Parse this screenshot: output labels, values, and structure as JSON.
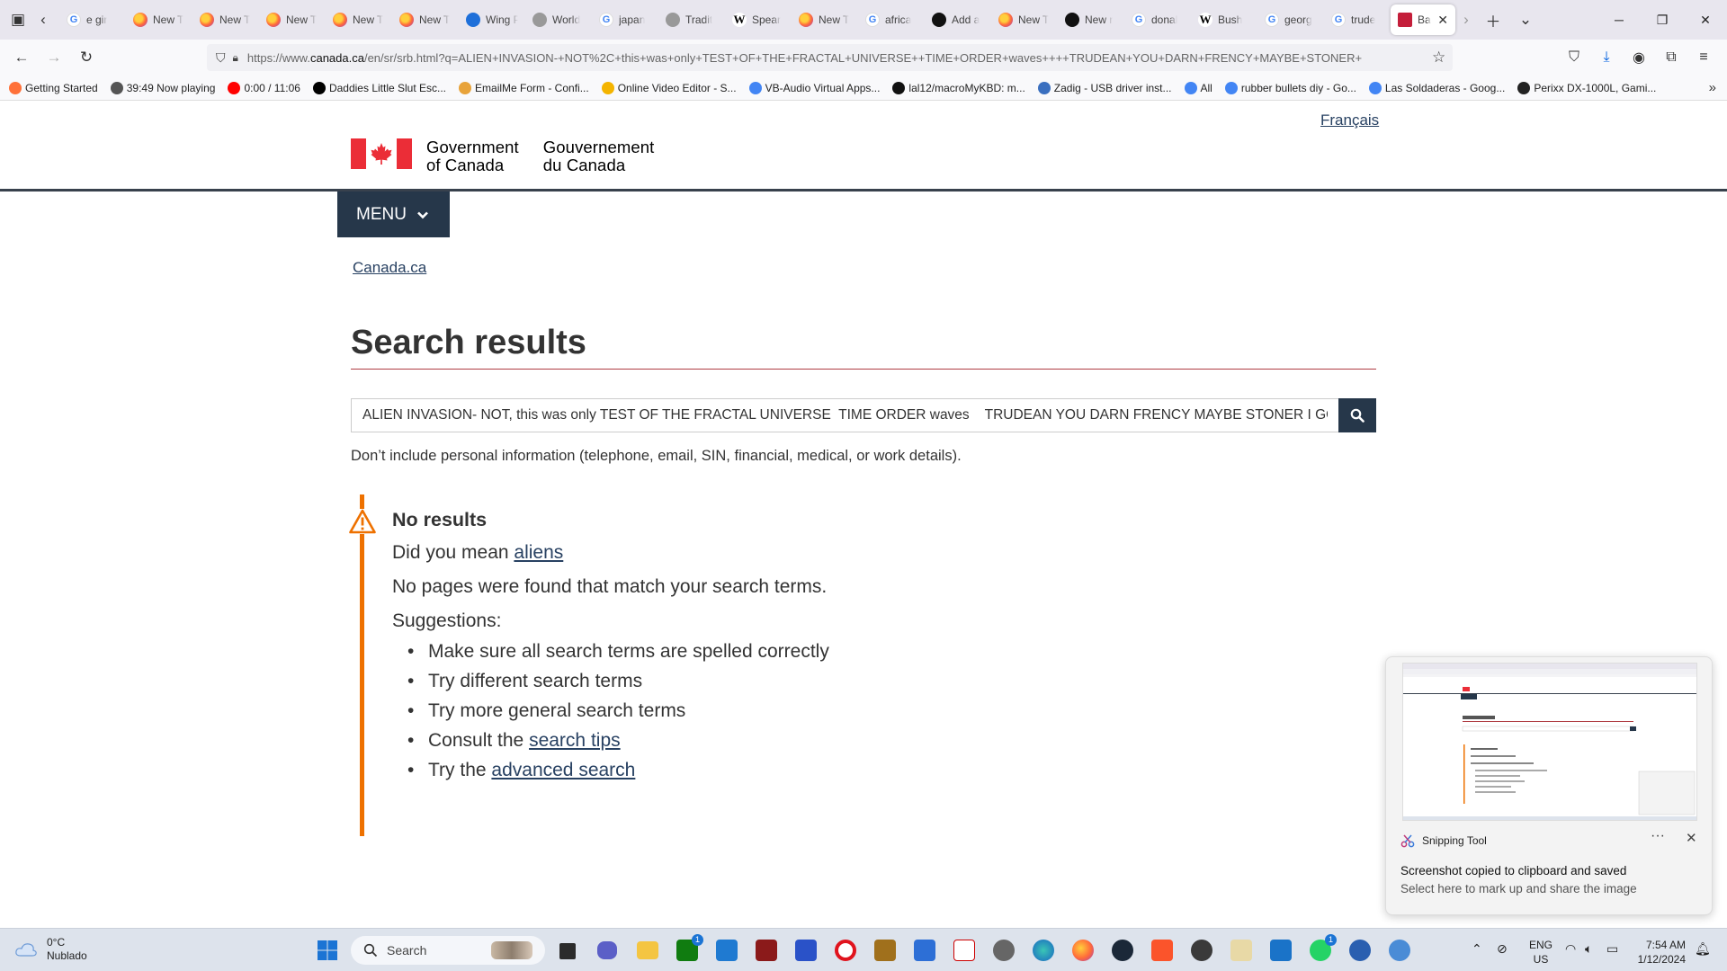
{
  "browser": {
    "tabs": [
      {
        "label": "e gir",
        "icon": "firefox-icon",
        "kind": "g"
      },
      {
        "label": "New T",
        "icon": "firefox-icon",
        "kind": "fx"
      },
      {
        "label": "New T",
        "icon": "firefox-icon",
        "kind": "fx"
      },
      {
        "label": "New T",
        "icon": "firefox-icon",
        "kind": "fx"
      },
      {
        "label": "New T",
        "icon": "firefox-icon",
        "kind": "fx"
      },
      {
        "label": "New T",
        "icon": "firefox-icon",
        "kind": "fx"
      },
      {
        "label": "Wing PLAYING",
        "icon": "audio-icon",
        "kind": "blue"
      },
      {
        "label": "World",
        "icon": "shield-icon",
        "kind": "gray"
      },
      {
        "label": "japan",
        "icon": "google-icon",
        "kind": "g"
      },
      {
        "label": "Tradit",
        "icon": "translate-icon",
        "kind": "gray"
      },
      {
        "label": "Spear",
        "icon": "wikipedia-icon",
        "kind": "w"
      },
      {
        "label": "New T",
        "icon": "firefox-icon",
        "kind": "fx"
      },
      {
        "label": "africa",
        "icon": "google-icon",
        "kind": "g"
      },
      {
        "label": "Add a",
        "icon": "github-icon",
        "kind": "gh"
      },
      {
        "label": "New T",
        "icon": "firefox-icon",
        "kind": "fx"
      },
      {
        "label": "New r",
        "icon": "github-icon",
        "kind": "gh"
      },
      {
        "label": "donal",
        "icon": "google-icon",
        "kind": "g"
      },
      {
        "label": "Bush",
        "icon": "wikipedia-icon",
        "kind": "w"
      },
      {
        "label": "georg",
        "icon": "google-icon",
        "kind": "g"
      },
      {
        "label": "trude",
        "icon": "google-icon",
        "kind": "g"
      }
    ],
    "active_tab": {
      "label": "Ba",
      "icon": "maple-leaf-icon"
    },
    "url_prefix": "https://www.",
    "url_domain": "canada.ca",
    "url_rest": "/en/sr/srb.html?q=ALIEN+INVASION-+NOT%2C+this+was+only+TEST+OF+THE+FRACTAL+UNIVERSE++TIME+ORDER+waves++++TRUDEAN+YOU+DARN+FRENCY+MAYBE+STONER+",
    "bookmarks": [
      {
        "label": "Getting Started",
        "icon": "firefox-icon",
        "color": "#ff7139"
      },
      {
        "label": "39:49  Now playing",
        "icon": "globe-icon",
        "color": "#555555"
      },
      {
        "label": "0:00 / 11:06",
        "icon": "youtube-icon",
        "color": "#ff0000"
      },
      {
        "label": "Daddies Little Slut Esc...",
        "icon": "sh-icon",
        "color": "#000000"
      },
      {
        "label": "EmailMe Form - Confi...",
        "icon": "form-icon",
        "color": "#e8a33a"
      },
      {
        "label": "Online Video Editor - S...",
        "icon": "video-icon",
        "color": "#f4b400"
      },
      {
        "label": "VB-Audio Virtual Apps...",
        "icon": "google-icon",
        "color": "#4285f4"
      },
      {
        "label": "lal12/macroMyKBD: m...",
        "icon": "github-icon",
        "color": "#111111"
      },
      {
        "label": "Zadig - USB driver inst...",
        "icon": "usb-icon",
        "color": "#3a6fbf"
      },
      {
        "label": "All",
        "icon": "google-icon",
        "color": "#4285f4"
      },
      {
        "label": "rubber bullets diy - Go...",
        "icon": "google-icon",
        "color": "#4285f4"
      },
      {
        "label": "Las Soldaderas - Goog...",
        "icon": "google-icon",
        "color": "#4285f4"
      },
      {
        "label": "Perixx DX-1000L, Gami...",
        "icon": "amazon-icon",
        "color": "#222222"
      }
    ]
  },
  "page": {
    "lang_toggle": "Français",
    "logo_en_1": "Government",
    "logo_en_2": "of Canada",
    "logo_fr_1": "Gouvernement",
    "logo_fr_2": "du Canada",
    "menu_label": "MENU",
    "breadcrumb": "Canada.ca",
    "title": "Search results",
    "search_value": "ALIEN INVASION- NOT, this was only TEST OF THE FRACTAL UNIVERSE  TIME ORDER waves    TRUDEAN YOU DARN FRENCY MAYBE STONER I GO",
    "privacy_note": "Don’t include personal information (telephone, email, SIN, financial, medical, or work details).",
    "alert": {
      "heading": "No results",
      "did_you_mean_prefix": "Did you mean ",
      "did_you_mean_link": "aliens",
      "no_pages": "No pages were found that match your search terms.",
      "suggestions_label": "Suggestions:",
      "suggestion_1": "Make sure all search terms are spelled correctly",
      "suggestion_2": "Try different search terms",
      "suggestion_3": "Try more general search terms",
      "suggestion_4_prefix": "Consult the ",
      "suggestion_4_link": "search tips",
      "suggestion_5_prefix": "Try the ",
      "suggestion_5_link": "advanced search"
    },
    "colors": {
      "gc_red": "#eb2d37",
      "gc_navy": "#26374a",
      "link": "#284162",
      "alert_orange": "#ee7100",
      "rule_red": "#af3c43"
    }
  },
  "toast": {
    "app": "Snipping Tool",
    "line1": "Screenshot copied to clipboard and saved",
    "line2": "Select here to mark up and share the image"
  },
  "taskbar": {
    "temp": "0°C",
    "condition": "Nublado",
    "search_label": "Search",
    "lang_1": "ENG",
    "lang_2": "US",
    "time": "7:54 AM",
    "date": "1/12/2024",
    "xbox_badge": "1",
    "whatsapp_badge": "1"
  }
}
